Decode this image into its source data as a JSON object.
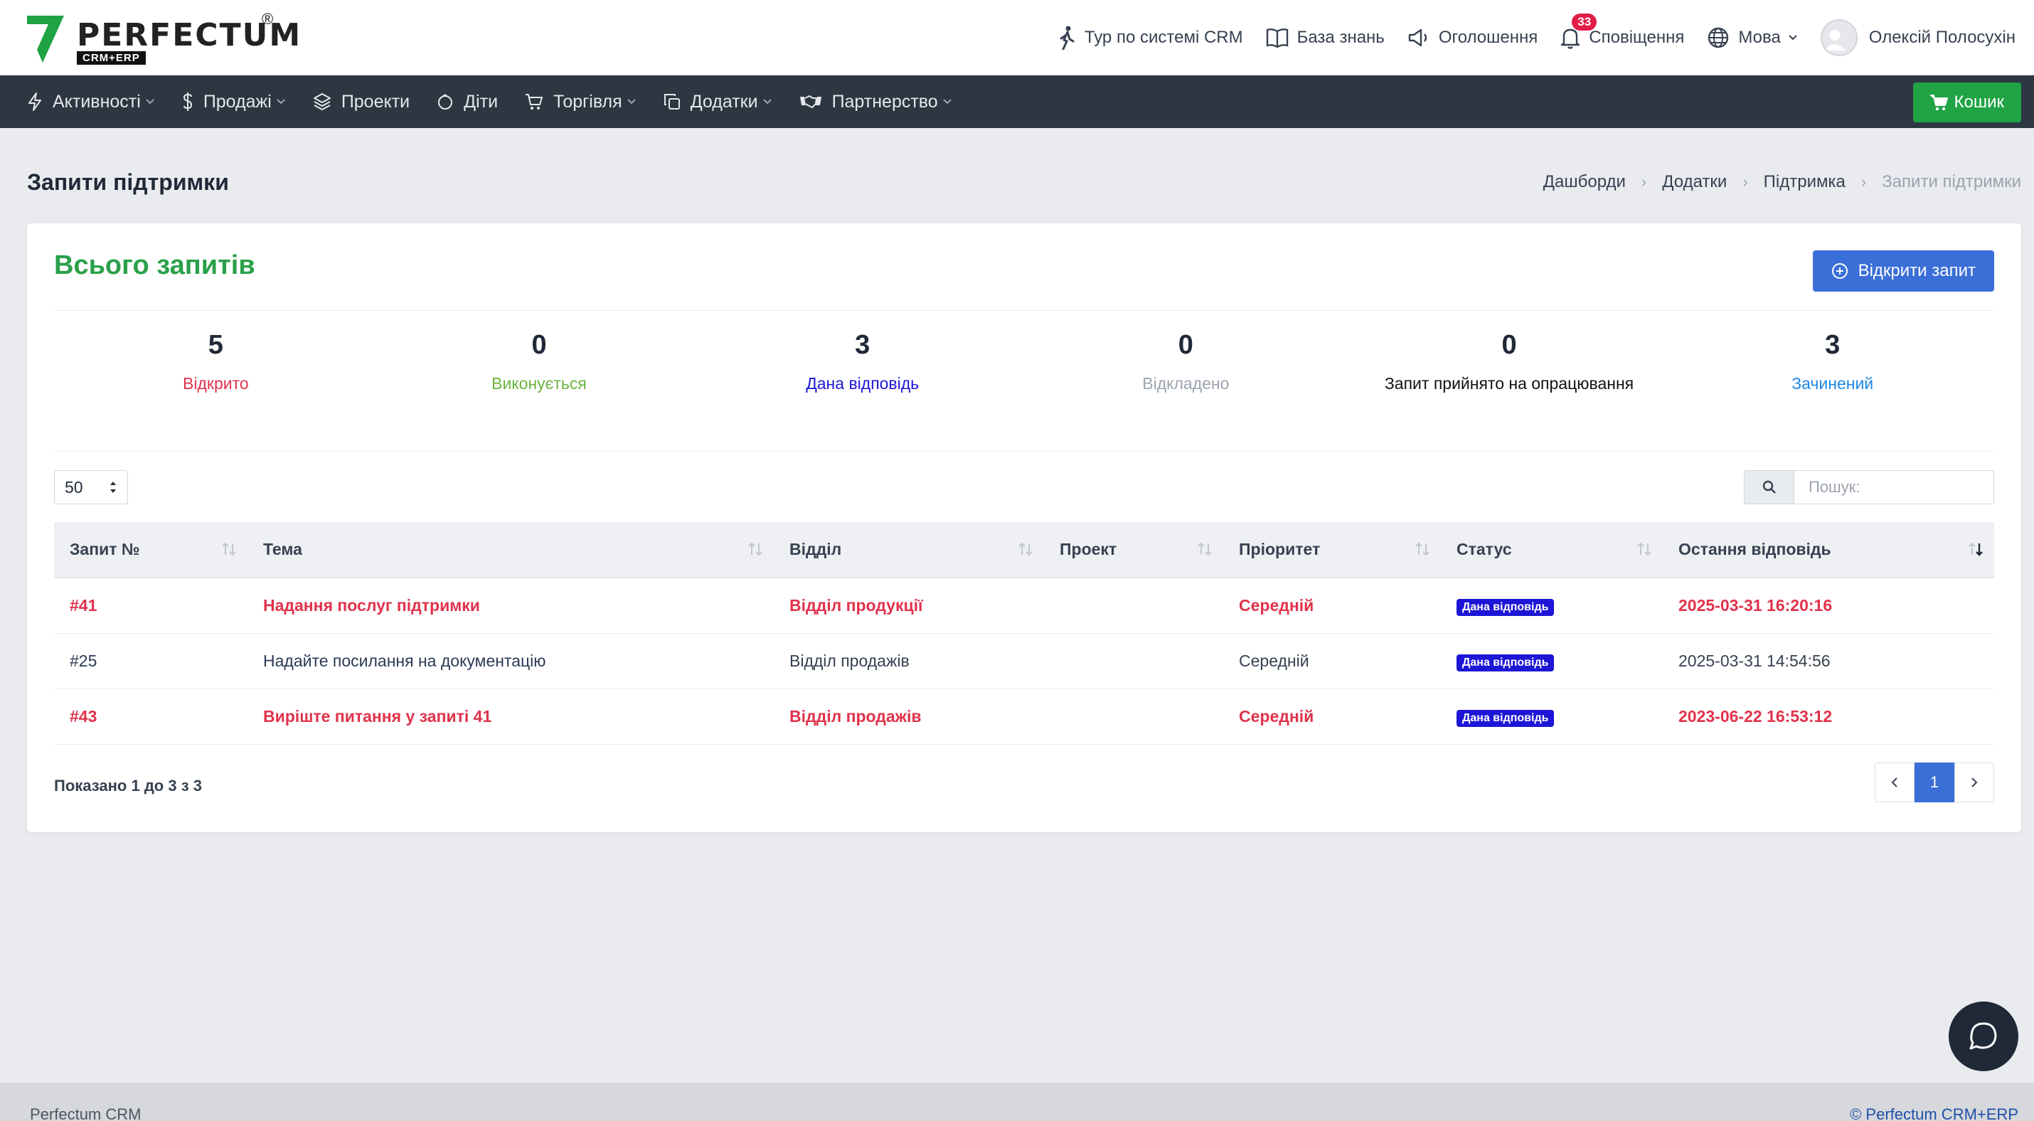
{
  "brand": {
    "name": "PERFECTUM",
    "sub": "CRM+ERP",
    "reg": "®"
  },
  "header": {
    "tour": "Тур по системі CRM",
    "kb": "База знань",
    "announcements": "Оголошення",
    "notifications": "Сповіщення",
    "notif_count": "33",
    "language": "Мова",
    "user": "Олексій Полосухін"
  },
  "nav": {
    "items": [
      "Активності",
      "Продажі",
      "Проекти",
      "Діти",
      "Торгівля",
      "Додатки",
      "Партнерство"
    ],
    "cart": "Кошик"
  },
  "page": {
    "title": "Запити підтримки",
    "breadcrumb": [
      "Дашборди",
      "Додатки",
      "Підтримка",
      "Запити підтримки"
    ]
  },
  "card": {
    "title": "Всього запитів",
    "open_button": "Відкрити запит",
    "stats": [
      {
        "value": "5",
        "label": "Відкрито",
        "color": "#e0324b"
      },
      {
        "value": "0",
        "label": "Виконується",
        "color": "#6cb33f"
      },
      {
        "value": "3",
        "label": "Дана відповідь",
        "color": "#1d16d6"
      },
      {
        "value": "0",
        "label": "Відкладено",
        "color": "#9ca3af"
      },
      {
        "value": "0",
        "label": "Запит прийнято на опрацювання",
        "color": "#111111"
      },
      {
        "value": "3",
        "label": "Зачинений",
        "color": "#1e88e5"
      }
    ],
    "page_length": "50",
    "search_placeholder": "Пошук:"
  },
  "table": {
    "columns": [
      "Запит №",
      "Тема",
      "Відділ",
      "Проект",
      "Пріоритет",
      "Статус",
      "Остання відповідь"
    ],
    "rows": [
      {
        "id": "#41",
        "subject": "Надання послуг підтримки",
        "department": "Відділ продукції",
        "project": "",
        "priority": "Середній",
        "status": "Дана відповідь",
        "last_reply": "2025-03-31 16:20:16"
      },
      {
        "id": "#25",
        "subject": "Надайте посилання на документацію",
        "department": "Відділ продажів",
        "project": "",
        "priority": "Середній",
        "status": "Дана відповідь",
        "last_reply": "2025-03-31 14:54:56"
      },
      {
        "id": "#43",
        "subject": "Вирiште питання у запиті 41",
        "department": "Відділ продажів",
        "project": "",
        "priority": "Середній",
        "status": "Дана відповідь",
        "last_reply": "2023-06-22 16:53:12"
      }
    ],
    "showing": "Показано 1 до 3 з 3",
    "current_page": "1"
  },
  "footer": {
    "left": "Perfectum CRM",
    "right": "© Perfectum CRM+ERP"
  }
}
